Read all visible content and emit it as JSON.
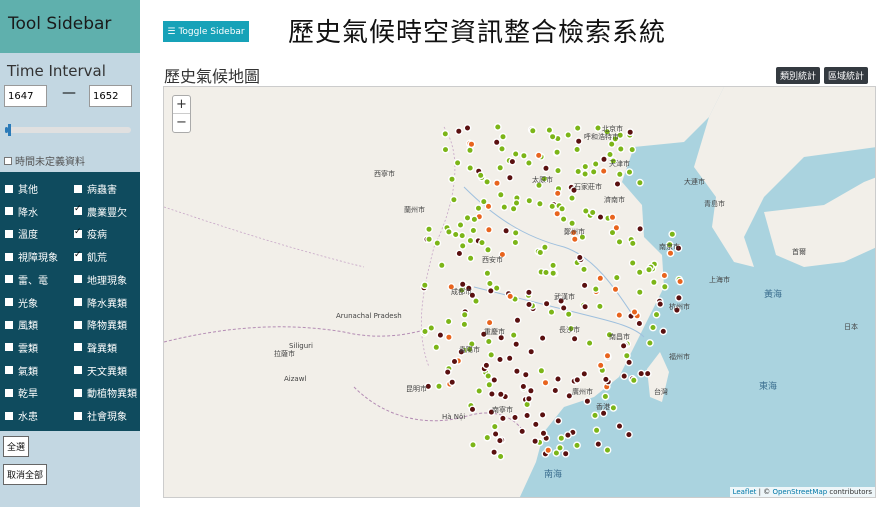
{
  "sidebar": {
    "title": "Tool Sidebar",
    "time_interval_label": "Time Interval",
    "start_year": "1647",
    "end_year": "1652",
    "range_dash": "—",
    "slider_value": 0.02,
    "undefined_label": "時間未定義資料",
    "categories": [
      {
        "label": "其他",
        "checked": false
      },
      {
        "label": "病蟲害",
        "checked": false
      },
      {
        "label": "降水",
        "checked": false
      },
      {
        "label": "農業豐欠",
        "checked": true
      },
      {
        "label": "溫度",
        "checked": false
      },
      {
        "label": "疫病",
        "checked": true
      },
      {
        "label": "視障現象",
        "checked": false
      },
      {
        "label": "飢荒",
        "checked": true
      },
      {
        "label": "雷、電",
        "checked": false
      },
      {
        "label": "地理現象",
        "checked": false
      },
      {
        "label": "光象",
        "checked": false
      },
      {
        "label": "降水異類",
        "checked": false
      },
      {
        "label": "風類",
        "checked": false
      },
      {
        "label": "降物異類",
        "checked": false
      },
      {
        "label": "雲類",
        "checked": false
      },
      {
        "label": "聲異類",
        "checked": false
      },
      {
        "label": "氣類",
        "checked": false
      },
      {
        "label": "天文異類",
        "checked": false
      },
      {
        "label": "乾旱",
        "checked": false
      },
      {
        "label": "動植物異類",
        "checked": false
      },
      {
        "label": "水患",
        "checked": false
      },
      {
        "label": "社會現象",
        "checked": false
      }
    ],
    "select_all_label": "全選",
    "deselect_all_label": "取消全部"
  },
  "header": {
    "toggle_label": "Toggle Sidebar",
    "app_title": "歷史氣候時空資訊整合檢索系統"
  },
  "map": {
    "title": "歷史氣候地圖",
    "btn_category": "類別統計",
    "btn_region": "區域統計",
    "zoom_in": "+",
    "zoom_out": "−",
    "attribution_leaflet": "Leaflet",
    "attribution_sep": " | © ",
    "attribution_osm": "OpenStreetMap",
    "attribution_tail": " contributors",
    "places": [
      {
        "name": "呼和浩特市"
      },
      {
        "name": "北京市"
      },
      {
        "name": "天津市"
      },
      {
        "name": "石家莊市"
      },
      {
        "name": "太原市"
      },
      {
        "name": "濟南市"
      },
      {
        "name": "鄭州市"
      },
      {
        "name": "西安市"
      },
      {
        "name": "蘭州市"
      },
      {
        "name": "西寧市"
      },
      {
        "name": "武漢市"
      },
      {
        "name": "南京市"
      },
      {
        "name": "上海市"
      },
      {
        "name": "杭州市"
      },
      {
        "name": "成都市"
      },
      {
        "name": "重慶市"
      },
      {
        "name": "長沙市"
      },
      {
        "name": "南昌市"
      },
      {
        "name": "福州市"
      },
      {
        "name": "廣州市"
      },
      {
        "name": "南寧市"
      },
      {
        "name": "昆明市"
      },
      {
        "name": "貴陽市"
      },
      {
        "name": "拉薩市"
      },
      {
        "name": "香港"
      },
      {
        "name": "台灣"
      },
      {
        "name": "大連市"
      },
      {
        "name": "青島市"
      },
      {
        "name": "首爾"
      },
      {
        "name": "日本"
      },
      {
        "name": "黃海"
      },
      {
        "name": "東海"
      },
      {
        "name": "南海"
      },
      {
        "name": "Hà Nội"
      },
      {
        "name": "Siliguri"
      },
      {
        "name": "Aizawl"
      },
      {
        "name": "Arunachal Pradesh"
      }
    ],
    "marker_colors": {
      "green": "#7cb518",
      "dark": "#5a1010",
      "orange": "#e8641e"
    }
  }
}
